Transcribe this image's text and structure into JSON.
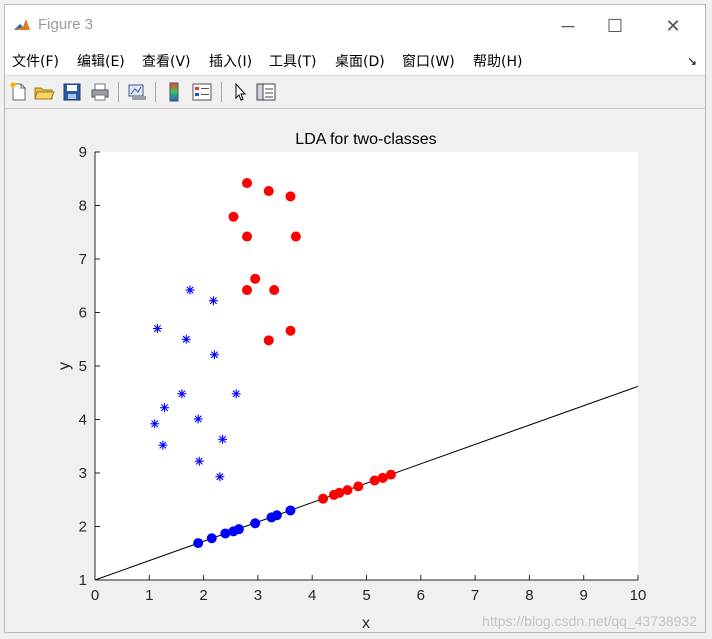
{
  "window": {
    "title": "Figure 3",
    "controls": {
      "minimize": "─",
      "maximize": "☐",
      "close": "✕"
    }
  },
  "menu": [
    {
      "label": "文件(F)"
    },
    {
      "label": "编辑(E)"
    },
    {
      "label": "查看(V)"
    },
    {
      "label": "插入(I)"
    },
    {
      "label": "工具(T)"
    },
    {
      "label": "桌面(D)"
    },
    {
      "label": "窗口(W)"
    },
    {
      "label": "帮助(H)"
    }
  ],
  "toolbar": {
    "icons": [
      "new-file-icon",
      "open-folder-icon",
      "save-icon",
      "print-icon",
      "link-plot-icon",
      "colorbar-icon",
      "legend-icon",
      "pointer-icon",
      "property-inspector-icon"
    ]
  },
  "watermark": "https://blog.csdn.net/qq_43738932",
  "colors": {
    "class1": "#0000ff",
    "class2": "#ff0000",
    "line": "#000000"
  },
  "chart_data": {
    "type": "scatter",
    "title": "LDA for two-classes",
    "xlabel": "x",
    "ylabel": "y",
    "xlim": [
      0,
      10
    ],
    "ylim": [
      1,
      9
    ],
    "xticks": [
      0,
      1,
      2,
      3,
      4,
      5,
      6,
      7,
      8,
      9,
      10
    ],
    "yticks": [
      1,
      2,
      3,
      4,
      5,
      6,
      7,
      8,
      9
    ],
    "grid": false,
    "series": [
      {
        "marker": "asterisk",
        "color": "#0000ff",
        "points": [
          [
            1.75,
            6.42
          ],
          [
            2.18,
            6.22
          ],
          [
            1.15,
            5.7
          ],
          [
            1.68,
            5.5
          ],
          [
            2.2,
            5.21
          ],
          [
            1.6,
            4.48
          ],
          [
            2.6,
            4.48
          ],
          [
            1.28,
            4.22
          ],
          [
            1.1,
            3.92
          ],
          [
            1.9,
            4.01
          ],
          [
            2.35,
            3.63
          ],
          [
            1.25,
            3.52
          ],
          [
            1.92,
            3.22
          ],
          [
            2.3,
            2.93
          ]
        ]
      },
      {
        "marker": "circle",
        "color": "#ff0000",
        "points": [
          [
            2.8,
            8.42
          ],
          [
            3.2,
            8.27
          ],
          [
            3.6,
            8.17
          ],
          [
            2.55,
            7.79
          ],
          [
            2.8,
            7.42
          ],
          [
            3.7,
            7.42
          ],
          [
            2.95,
            6.63
          ],
          [
            2.8,
            6.42
          ],
          [
            3.3,
            6.42
          ],
          [
            3.6,
            5.66
          ],
          [
            3.2,
            5.48
          ]
        ]
      },
      {
        "marker": "circle",
        "color": "#0000ff",
        "points": [
          [
            1.9,
            1.69
          ],
          [
            2.15,
            1.78
          ],
          [
            2.4,
            1.87
          ],
          [
            2.55,
            1.91
          ],
          [
            2.65,
            1.95
          ],
          [
            2.95,
            2.06
          ],
          [
            3.25,
            2.17
          ],
          [
            3.35,
            2.21
          ],
          [
            3.6,
            2.3
          ]
        ]
      },
      {
        "marker": "circle",
        "color": "#ff0000",
        "points": [
          [
            4.2,
            2.52
          ],
          [
            4.4,
            2.59
          ],
          [
            4.5,
            2.63
          ],
          [
            4.65,
            2.68
          ],
          [
            4.85,
            2.75
          ],
          [
            5.15,
            2.86
          ],
          [
            5.3,
            2.91
          ],
          [
            5.45,
            2.97
          ]
        ]
      }
    ],
    "line": {
      "color": "#000000",
      "points": [
        [
          0,
          1.0
        ],
        [
          10,
          4.62
        ]
      ]
    }
  }
}
